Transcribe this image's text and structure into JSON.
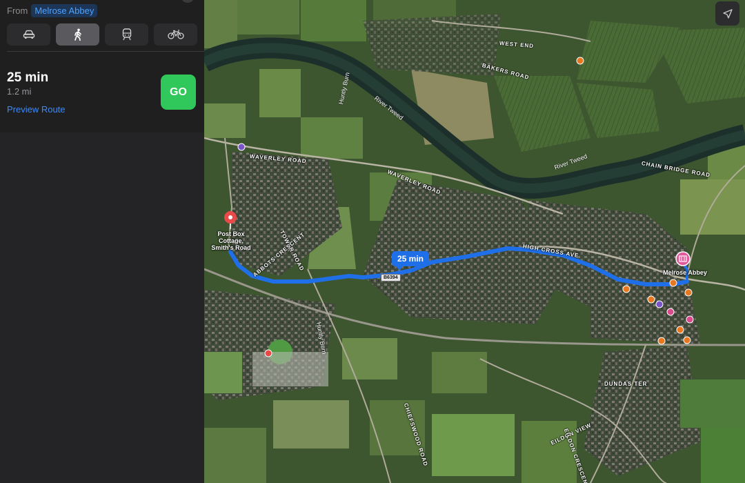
{
  "sidebar": {
    "from_label": "From",
    "from_place": "Melrose Abbey",
    "modes": [
      {
        "name": "drive",
        "icon": "car-icon",
        "active": false
      },
      {
        "name": "walk",
        "icon": "walk-icon",
        "active": true
      },
      {
        "name": "transit",
        "icon": "train-icon",
        "active": false
      },
      {
        "name": "cycle",
        "icon": "bicycle-icon",
        "active": false
      }
    ],
    "time": "25 min",
    "distance": "1.2 mi",
    "preview_link": "Preview Route",
    "go_button": "GO",
    "go_color": "#30c85a",
    "link_color": "#3d8af7"
  },
  "map": {
    "route_callout": "25 min",
    "route_color": "#1f6fe8",
    "road_shield": "B6394",
    "destination_label": "Post Box Cottage, Smith's Road",
    "origin_label": "Melrose Abbey",
    "road_labels": {
      "waverley_1": "WAVERLEY ROAD",
      "waverley_2": "WAVERLEY ROAD",
      "high_cross": "HIGH CROSS AVE",
      "chain_bridge": "CHAIN BRIDGE ROAD",
      "west_end": "WEST END",
      "bakers": "BAKERS ROAD",
      "tower": "TOWER ROAD",
      "abbots": "ABBOTS CRESCENT",
      "chiefswood": "CHIEFSWOOD ROAD",
      "dundas": "DUNDAS TER",
      "eildon_view": "EILDON VIEW",
      "eildon_crescent": "EILDON CRESCENT",
      "huntly_1": "Huntly Burn",
      "huntly_2": "Huntly Burn"
    },
    "river_labels": {
      "tweed_1": "River Tweed",
      "tweed_2": "River Tweed"
    },
    "icons": [
      "location-arrow-icon",
      "pin-icon",
      "museum-icon"
    ]
  }
}
